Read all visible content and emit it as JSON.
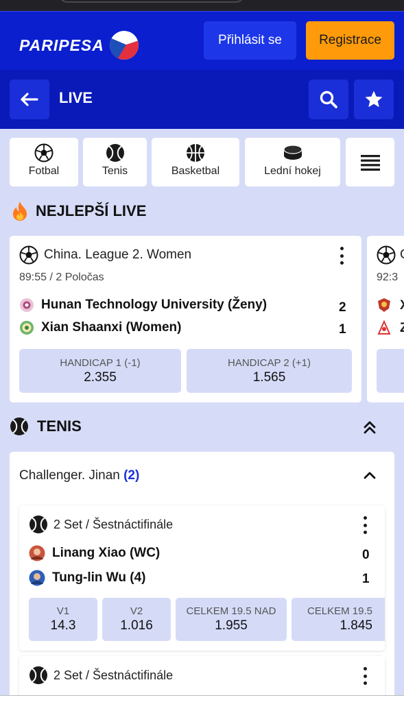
{
  "header": {
    "logo_text": "PARIPESA",
    "login_label": "Přihlásit se",
    "register_label": "Registrace"
  },
  "livebar": {
    "title": "LIVE"
  },
  "sports_tabs": [
    {
      "label": "Fotbal",
      "icon": "soccer-ball-icon"
    },
    {
      "label": "Tenis",
      "icon": "tennis-ball-icon"
    },
    {
      "label": "Basketbal",
      "icon": "basketball-icon"
    },
    {
      "label": "Lední hokej",
      "icon": "hockey-puck-icon"
    }
  ],
  "best_live": {
    "title": "NEJLEPŠÍ LIVE",
    "card": {
      "league": "China. League 2. Women",
      "time": "89:55 / 2 Poločas",
      "team1": "Hunan Technology University (Ženy)",
      "team2": "Xian Shaanxi (Women)",
      "score1": "2",
      "score2": "1",
      "odds": [
        {
          "label": "HANDICAP 1 (-1)",
          "value": "2.355"
        },
        {
          "label": "HANDICAP 2 (+1)",
          "value": "1.565"
        }
      ]
    },
    "peek_card": {
      "league": "C",
      "time": "92:3",
      "team1": "X",
      "team2": "Z"
    }
  },
  "tennis": {
    "title": "TENIS",
    "league": "Challenger. Jinan",
    "league_count": "(2)",
    "match1": {
      "stage": "2 Set / Šestnáctifinále",
      "player1": "Linang Xiao (WC)",
      "player2": "Tung-lin Wu (4)",
      "score1": "0",
      "score2": "1",
      "odds": [
        {
          "label": "V1",
          "value": "14.3"
        },
        {
          "label": "V2",
          "value": "1.016"
        },
        {
          "label": "CELKEM 19.5 NAD",
          "value": "1.955"
        },
        {
          "label": "CELKEM 19.5",
          "value": "1.845"
        }
      ]
    },
    "match2": {
      "stage": "2 Set / Šestnáctifinále"
    }
  },
  "colors": {
    "brand_blue": "#0b1fcf",
    "register_orange": "#ff9a0a",
    "count_blue": "#1a2fd8"
  }
}
